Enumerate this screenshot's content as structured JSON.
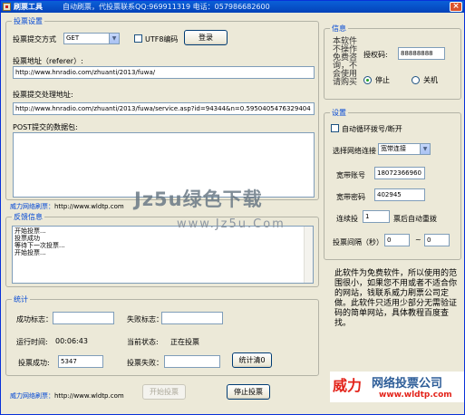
{
  "titlebar": {
    "title": "刷票工具",
    "subtitle": "自动刷票，代投票联系QQ:969911319   电话：057986682600"
  },
  "vote_settings": {
    "group_label": "投票设置",
    "method_label": "投票提交方式",
    "method_value": "GET",
    "utf8_label": "UTF8编码",
    "utf8_checked": false,
    "login_button": "登录",
    "referer_label": "投票地址（referer）:",
    "referer_value": "http://www.hnradio.com/zhuanti/2013/fuwa/",
    "handler_label": "投票提交处理地址:",
    "handler_value": "http://www.hnradio.com/zhuanti/2013/fuwa/service.asp?id=94344&n=0.5950405476329404",
    "post_label": "POST提交的数据包:",
    "post_value": ""
  },
  "site_link_top": {
    "label": "威力网络刷票：",
    "url": "http://www.wldtp.com"
  },
  "feedback": {
    "group_label": "反馈信息",
    "lines": [
      "开始投票...",
      "投票成功",
      "等待下一次投票...",
      "开始投票..."
    ]
  },
  "stats": {
    "group_label": "统计",
    "success_flag_label": "成功标志：",
    "success_flag_value": "",
    "fail_flag_label": "失败标志：",
    "fail_flag_value": "",
    "runtime_label": "运行时间:",
    "runtime_value": "00:06:43",
    "status_label": "当前状态:",
    "status_value": "正在投票",
    "success_count_label": "投票成功:",
    "success_count_value": "5347",
    "fail_count_label": "投票失败：",
    "fail_count_value": "",
    "reset_button": "统计清0"
  },
  "site_link_bottom": {
    "label": "威力网络刷票：",
    "url": "http://www.wldtp.com"
  },
  "actions": {
    "start_button": "开始投票",
    "stop_button": "停止投票"
  },
  "info": {
    "group_label": "信息",
    "notice": "本软件不操作免费咨询，不会使用请购买",
    "code_label": "授权码:",
    "code_value": "88888888",
    "radio_stop": "停止",
    "radio_shutdown": "关机",
    "selected": "停止"
  },
  "settings": {
    "group_label": "设置",
    "auto_redial_label": "自动循环拨号/断开",
    "auto_redial_checked": false,
    "connection_label": "选择网络连接",
    "connection_value": "宽带连接",
    "account_label": "宽带账号",
    "account_value": "18072366960",
    "password_label": "宽带密码",
    "password_value": "402945",
    "redial_label": "连续投",
    "redial_value": "1",
    "redial_suffix": "票后自动重拨",
    "interval_label": "投票间隔（秒）",
    "interval_from": "0",
    "interval_sep": "~",
    "interval_to": "0"
  },
  "watermark": {
    "text": "Jz5u绿色下载",
    "url": "www.Jz5u.Com"
  },
  "promo_text": "此软件为免费软件，所以使用的范围很小，如果您不用或者不适合你的网站，钱联系威力刷票公司定做。此软件只适用少部分无需验证码的简单网站，具体教程百度查找。",
  "brand": {
    "big": "威力",
    "name": "网络投票公司",
    "url": "www.wldtp.com"
  },
  "colors": {
    "title_bar": "#0a5fd8",
    "group_label": "#0046d5",
    "brand_red": "#e3231a",
    "brand_blue": "#2d5d98"
  }
}
